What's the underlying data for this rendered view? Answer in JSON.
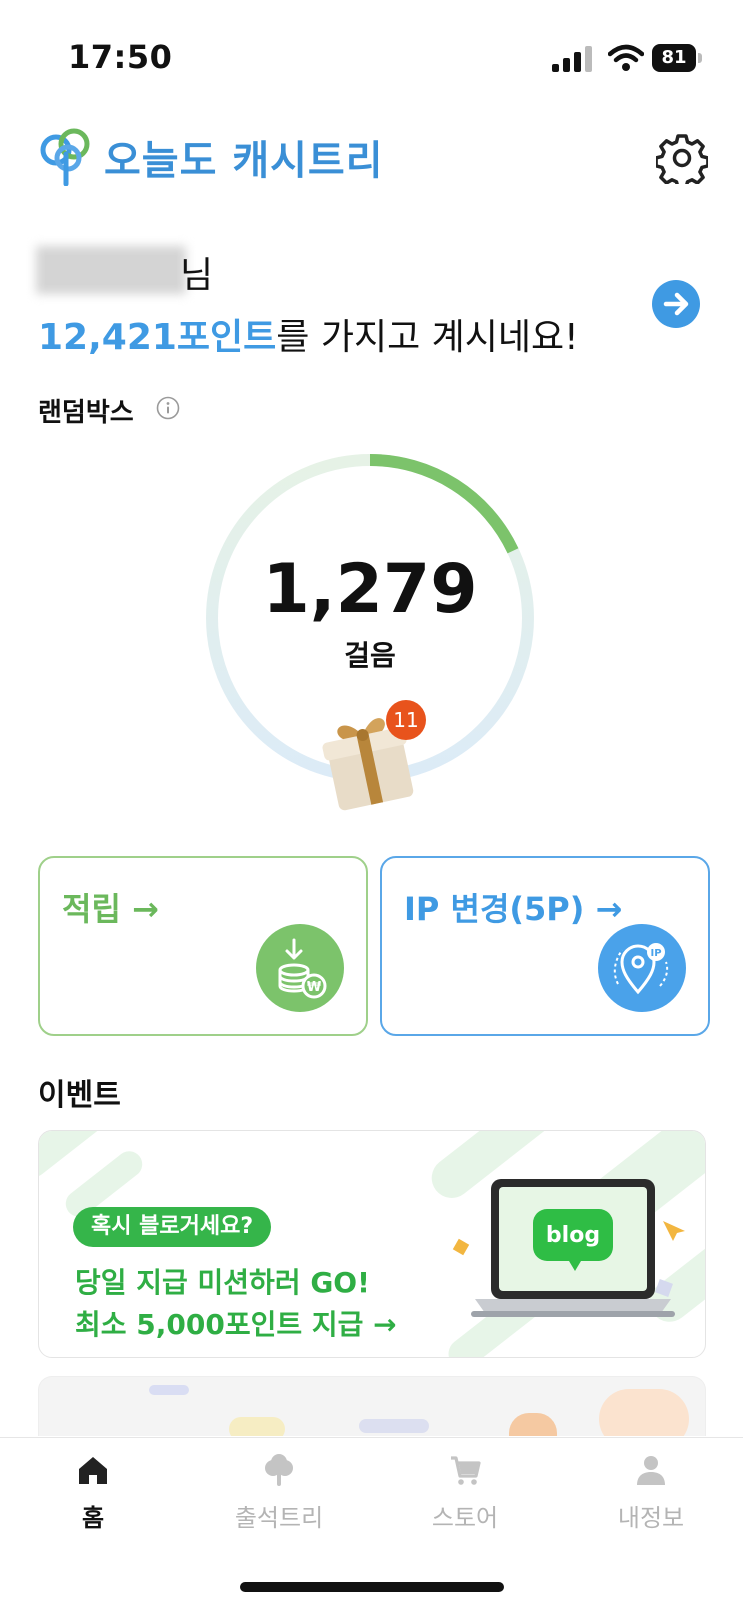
{
  "status_bar": {
    "time": "17:50",
    "battery": "81"
  },
  "header": {
    "logo_text": "오늘도 캐시트리"
  },
  "greeting": {
    "name_suffix": "님",
    "points": "12,421포인트",
    "points_suffix": "를 가지고 계시네요!"
  },
  "random_box": {
    "title": "랜덤박스",
    "steps": "1,279",
    "steps_label": "걸음",
    "gift_count": "11",
    "progress": 0.18
  },
  "actions": {
    "earn_label": "적립 →",
    "ip_change_label": "IP 변경(5P) →"
  },
  "events": {
    "title": "이벤트",
    "banner": {
      "pill": "혹시 블로거세요?",
      "line1": "당일 지급 미션하러 GO!",
      "line2": "최소 5,000포인트 지급 →",
      "laptop_text": "blog"
    }
  },
  "tabs": [
    {
      "label": "홈",
      "icon": "home-icon",
      "active": true
    },
    {
      "label": "출석트리",
      "icon": "tree-icon",
      "active": false
    },
    {
      "label": "스토어",
      "icon": "cart-icon",
      "active": false
    },
    {
      "label": "내정보",
      "icon": "person-icon",
      "active": false
    }
  ],
  "colors": {
    "brand_blue": "#3f9ae3",
    "brand_green": "#6bb85c",
    "badge_orange": "#e8531c"
  }
}
